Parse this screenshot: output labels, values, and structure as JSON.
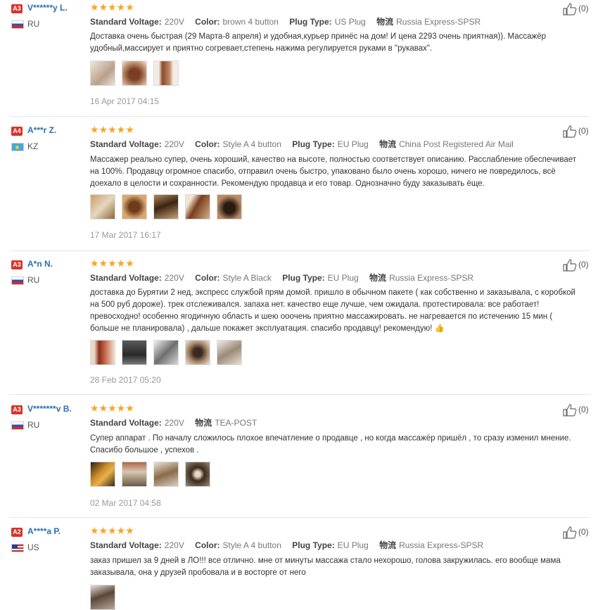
{
  "labels": {
    "voltage": "Standard Voltage:",
    "color": "Color:",
    "plug": "Plug Type:",
    "logistics": "物流"
  },
  "reviews": [
    {
      "badge": "A3",
      "user": "V******y L.",
      "country": "RU",
      "stars": "★★★★★",
      "voltage": "220V",
      "color": "brown 4 button",
      "plug": "US Plug",
      "logistics": "Russia Express-SPSR",
      "text": "Доставка очень быстрая (29 Марта-8 апреля) и удобная,курьер принёс на дом! И цена 2293 очень приятная)). Массажёр удобный,массирует и приятно согревает,степень нажима регулируется руками в \"рукавах\".",
      "date": "16 Apr 2017 04:15",
      "likes": "(0)"
    },
    {
      "badge": "A4",
      "user": "A***r Z.",
      "country": "KZ",
      "stars": "★★★★★",
      "voltage": "220V",
      "color": "Style A 4 button",
      "plug": "EU Plug",
      "logistics": "China Post Registered Air Mail",
      "text": "Массажер реально супер, очень хороший, качество на высоте, полностью соответствует описанию. Расслабление обеспечивает на 100%. Продавцу огромное спасибо, отправил очень быстро, упаковано было очень хорошо, ничего не повредилось, всё доехало в целости и сохранности. Рекомендую продавца и его товар. Однозначно буду заказывать ёще.",
      "date": "17 Mar 2017 16:17",
      "likes": "(0)"
    },
    {
      "badge": "A3",
      "user": "A*n N.",
      "country": "RU",
      "stars": "★★★★★",
      "voltage": "220V",
      "color": "Style A Black",
      "plug": "EU Plug",
      "logistics": "Russia Express-SPSR",
      "text": "доставка до Бурятии 2 нед, экспресс службой прям домой. пришло в обычном пакете ( как собственно и заказывала, с коробкой на 500 руб дороже). трек отслеживался. запаха нет. качество еще лучше, чем ожидала. протестировала: все работает! превосходно! особенно ягодичную область и шею ооочень приятно массажировать. не нагревается по истечению 15 мин ( больше не планировала) , дальше покажет эксплуатация. спасибо продавцу! рекомендую! 👍",
      "date": "28 Feb 2017 05:20",
      "likes": "(0)"
    },
    {
      "badge": "A3",
      "user": "V*******v B.",
      "country": "RU",
      "stars": "★★★★★",
      "voltage": "220V",
      "color": "",
      "plug": "",
      "logistics": "TEA-POST",
      "text": "Супер аппарат . По началу сложилось плохое впечатление о продавце , но когда массажёр пришёл , то сразу изменил мнение. Спасибо большое , успехов .",
      "date": "02 Mar 2017 04:58",
      "likes": "(0)"
    },
    {
      "badge": "A2",
      "user": "A****a P.",
      "country": "US",
      "stars": "★★★★★",
      "voltage": "220V",
      "color": "Style A 4 button",
      "plug": "EU Plug",
      "logistics": "Russia Express-SPSR",
      "text": "заказ пришел за 9 дней в ЛО!!! все отлично. мне от минуты массажа стало нехорошо, голова закружилась. его вообще мама заказывала, она у друзей пробовала и в восторге от него",
      "date": "",
      "likes": "(0)"
    }
  ]
}
